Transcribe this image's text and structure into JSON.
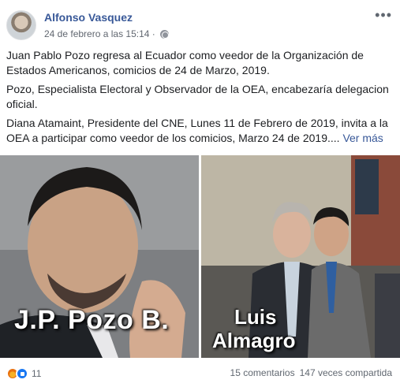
{
  "post": {
    "author": "Alfonso Vasquez",
    "timestamp": "24 de febrero a las 15:14 ·",
    "privacy_icon": "globe-icon",
    "more_icon": "more-options-icon",
    "paragraphs": [
      "Juan Pablo Pozo regresa al Ecuador como veedor de la Organización de Estados Americanos, comicios de 24 de Marzo, 2019.",
      "Pozo, Especialista Electoral y Observador de la OEA, encabezaría delegacion oficial.",
      "Diana Atamaint, Presidente del CNE, Lunes 11 de Febrero de 2019, invita a la OEA a participar como veedor de los comicios, Marzo 24 de 2019...."
    ],
    "see_more": "Ver más"
  },
  "photos": {
    "left_caption": "J.P. Pozo B.",
    "right_caption_line1": "Luis",
    "right_caption_line2": "Almagro"
  },
  "footer": {
    "reactions": [
      "angry-icon",
      "like-icon"
    ],
    "reaction_count": "11",
    "comments": "15 comentarios",
    "shares": "147 veces compartida"
  },
  "colors": {
    "link": "#385898",
    "meta": "#616770",
    "like": "#1877f2"
  }
}
